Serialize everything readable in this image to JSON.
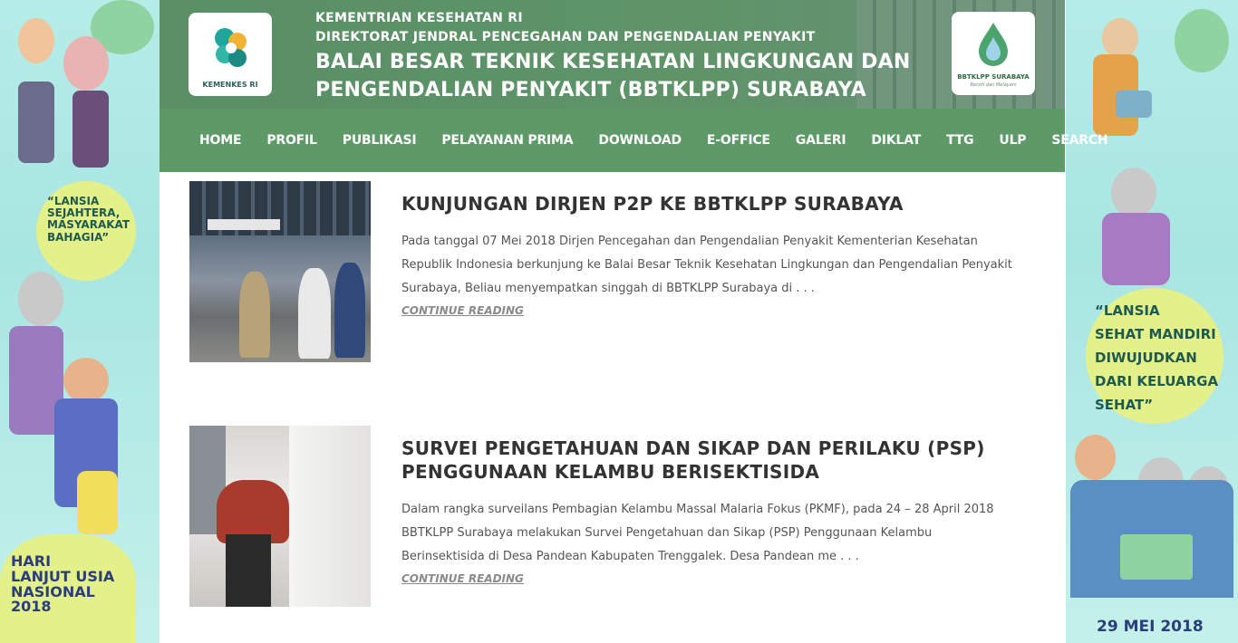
{
  "left_banner": {
    "quote": "“LANSIA SEJAHTERA, MASYARAKAT BAHAGIA”",
    "quote_lines": [
      "“LANSIA",
      "SEJAHTERA,",
      "MASYARAKAT",
      "BAHAGIA”"
    ],
    "event_lines": [
      "HARI",
      "LANJUT USIA",
      "NASIONAL",
      "2018"
    ]
  },
  "right_banner": {
    "quote_lines": [
      "“LANSIA",
      "SEHAT MANDIRI",
      "DIWUJUDKAN",
      "DARI KELUARGA",
      "SEHAT”"
    ],
    "date": "29 MEI 2018"
  },
  "header": {
    "line1": "KEMENTRIAN KESEHATAN RI",
    "line2": "DIREKTORAT JENDRAL PENCEGAHAN DAN PENGENDALIAN PENYAKIT",
    "line3": "BALAI BESAR TEKNIK KESEHATAN LINGKUNGAN DAN",
    "line4": "PENGENDALIAN PENYAKIT (BBTKLPP) SURABAYA",
    "logo_left_caption": "KEMENKES RI",
    "logo_right_caption": "BBTKLPP SURABAYA",
    "logo_right_sub": "Bersih dan Melayani"
  },
  "nav": {
    "items": [
      "HOME",
      "PROFIL",
      "PUBLIKASI",
      "PELAYANAN PRIMA",
      "DOWNLOAD",
      "E-OFFICE",
      "GALERI",
      "DIKLAT",
      "TTG",
      "ULP",
      "SEARCH"
    ]
  },
  "posts": [
    {
      "title": "KUNJUNGAN DIRJEN P2P KE BBTKLPP SURABAYA",
      "excerpt": "Pada tanggal 07 Mei 2018 Dirjen Pencegahan dan Pengendalian Penyakit Kementerian Kesehatan Republik Indonesia berkunjung ke Balai Besar Teknik Kesehatan Lingkungan dan Pengendalian Penyakit Surabaya, Beliau menyempatkan singgah di BBTKLPP Surabaya di . . .",
      "more": "CONTINUE READING"
    },
    {
      "title": "SURVEI PENGETAHUAN DAN SIKAP DAN PERILAKU (PSP) PENGGUNAAN KELAMBU BERISEKTISIDA",
      "excerpt": "Dalam rangka surveilans Pembagian Kelambu Massal Malaria Fokus (PKMF), pada 24 – 28 April 2018 BBTKLPP Surabaya melakukan Survei Pengetahuan dan Sikap (PSP) Penggunaan Kelambu Berinsektisida di Desa Pandean Kabupaten Trenggalek. Desa Pandean me . . .",
      "more": "CONTINUE READING"
    }
  ],
  "colors": {
    "header_green": "#5a8f66",
    "nav_green": "#5e9a68",
    "banner_teal": "#b5ece8"
  }
}
